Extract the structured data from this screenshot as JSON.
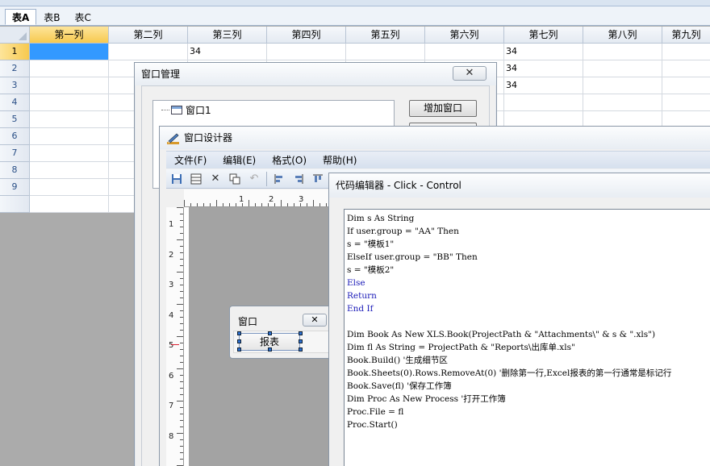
{
  "sheet_tabs": [
    {
      "label": "表A",
      "active": true
    },
    {
      "label": "表B",
      "active": false
    },
    {
      "label": "表C",
      "active": false
    }
  ],
  "grid": {
    "columns": [
      "第一列",
      "第二列",
      "第三列",
      "第四列",
      "第五列",
      "第六列",
      "第七列",
      "第八列",
      "第九列"
    ],
    "rows": [
      {
        "num": "1",
        "cells": [
          "",
          "",
          "34",
          "",
          "",
          "",
          "34",
          "",
          ""
        ]
      },
      {
        "num": "2",
        "cells": [
          "",
          "",
          "",
          "",
          "",
          "",
          "34",
          "",
          ""
        ]
      },
      {
        "num": "3",
        "cells": [
          "",
          "",
          "",
          "",
          "",
          "",
          "34",
          "",
          ""
        ]
      },
      {
        "num": "4",
        "cells": [
          "",
          "",
          "",
          "",
          "",
          "",
          "",
          "",
          ""
        ]
      },
      {
        "num": "5",
        "cells": [
          "",
          "",
          "",
          "",
          "",
          "",
          "",
          "",
          ""
        ]
      },
      {
        "num": "6",
        "cells": [
          "",
          "",
          "",
          "",
          "",
          "",
          "",
          "",
          ""
        ]
      },
      {
        "num": "7",
        "cells": [
          "",
          "",
          "",
          "",
          "",
          "",
          "",
          "",
          ""
        ]
      },
      {
        "num": "8",
        "cells": [
          "",
          "",
          "",
          "",
          "",
          "",
          "",
          "",
          ""
        ]
      },
      {
        "num": "9",
        "cells": [
          "",
          "",
          "",
          "",
          "",
          "",
          "",
          "",
          ""
        ]
      }
    ]
  },
  "window_manager": {
    "title": "窗口管理",
    "close_glyph": "✕",
    "tree_item": "窗口1",
    "add_window_button": "增加窗口"
  },
  "designer": {
    "title": "窗口设计器",
    "menu": [
      "文件(F)",
      "编辑(E)",
      "格式(O)",
      "帮助(H)"
    ],
    "toolbar_icons": [
      "save-icon",
      "table-icon",
      "cut-icon",
      "copy-icon",
      "align-left-icon",
      "align-right-icon",
      "align-top-icon"
    ],
    "ruler_h": [
      "1",
      "2",
      "3"
    ],
    "ruler_v": [
      "1",
      "2",
      "3",
      "4",
      "5",
      "6",
      "7",
      "8"
    ],
    "mini_window": {
      "title": "窗口",
      "close_glyph": "✕",
      "button": "报表"
    }
  },
  "code_editor": {
    "title": "代码编辑器 - Click - Control",
    "lines": [
      "Dim s As String",
      "If user.group = \"AA\" Then",
      "s = \"模板1\"",
      "ElseIf user.group = \"BB\" Then",
      "s = \"模板2\"",
      "Else",
      "Return",
      "End If",
      "",
      "Dim Book As New XLS.Book(ProjectPath & \"Attachments\\\" & s & \".xls\")",
      "Dim fl As String = ProjectPath & \"Reports\\出库单.xls\"",
      "Book.Build() '生成细节区",
      "Book.Sheets(0).Rows.RemoveAt(0) '删除第一行,Excel报表的第一行通常是标记行",
      "Book.Save(fl) '保存工作簿",
      "Dim Proc As New Process '打开工作簿",
      "Proc.File = fl",
      "Proc.Start()"
    ]
  }
}
